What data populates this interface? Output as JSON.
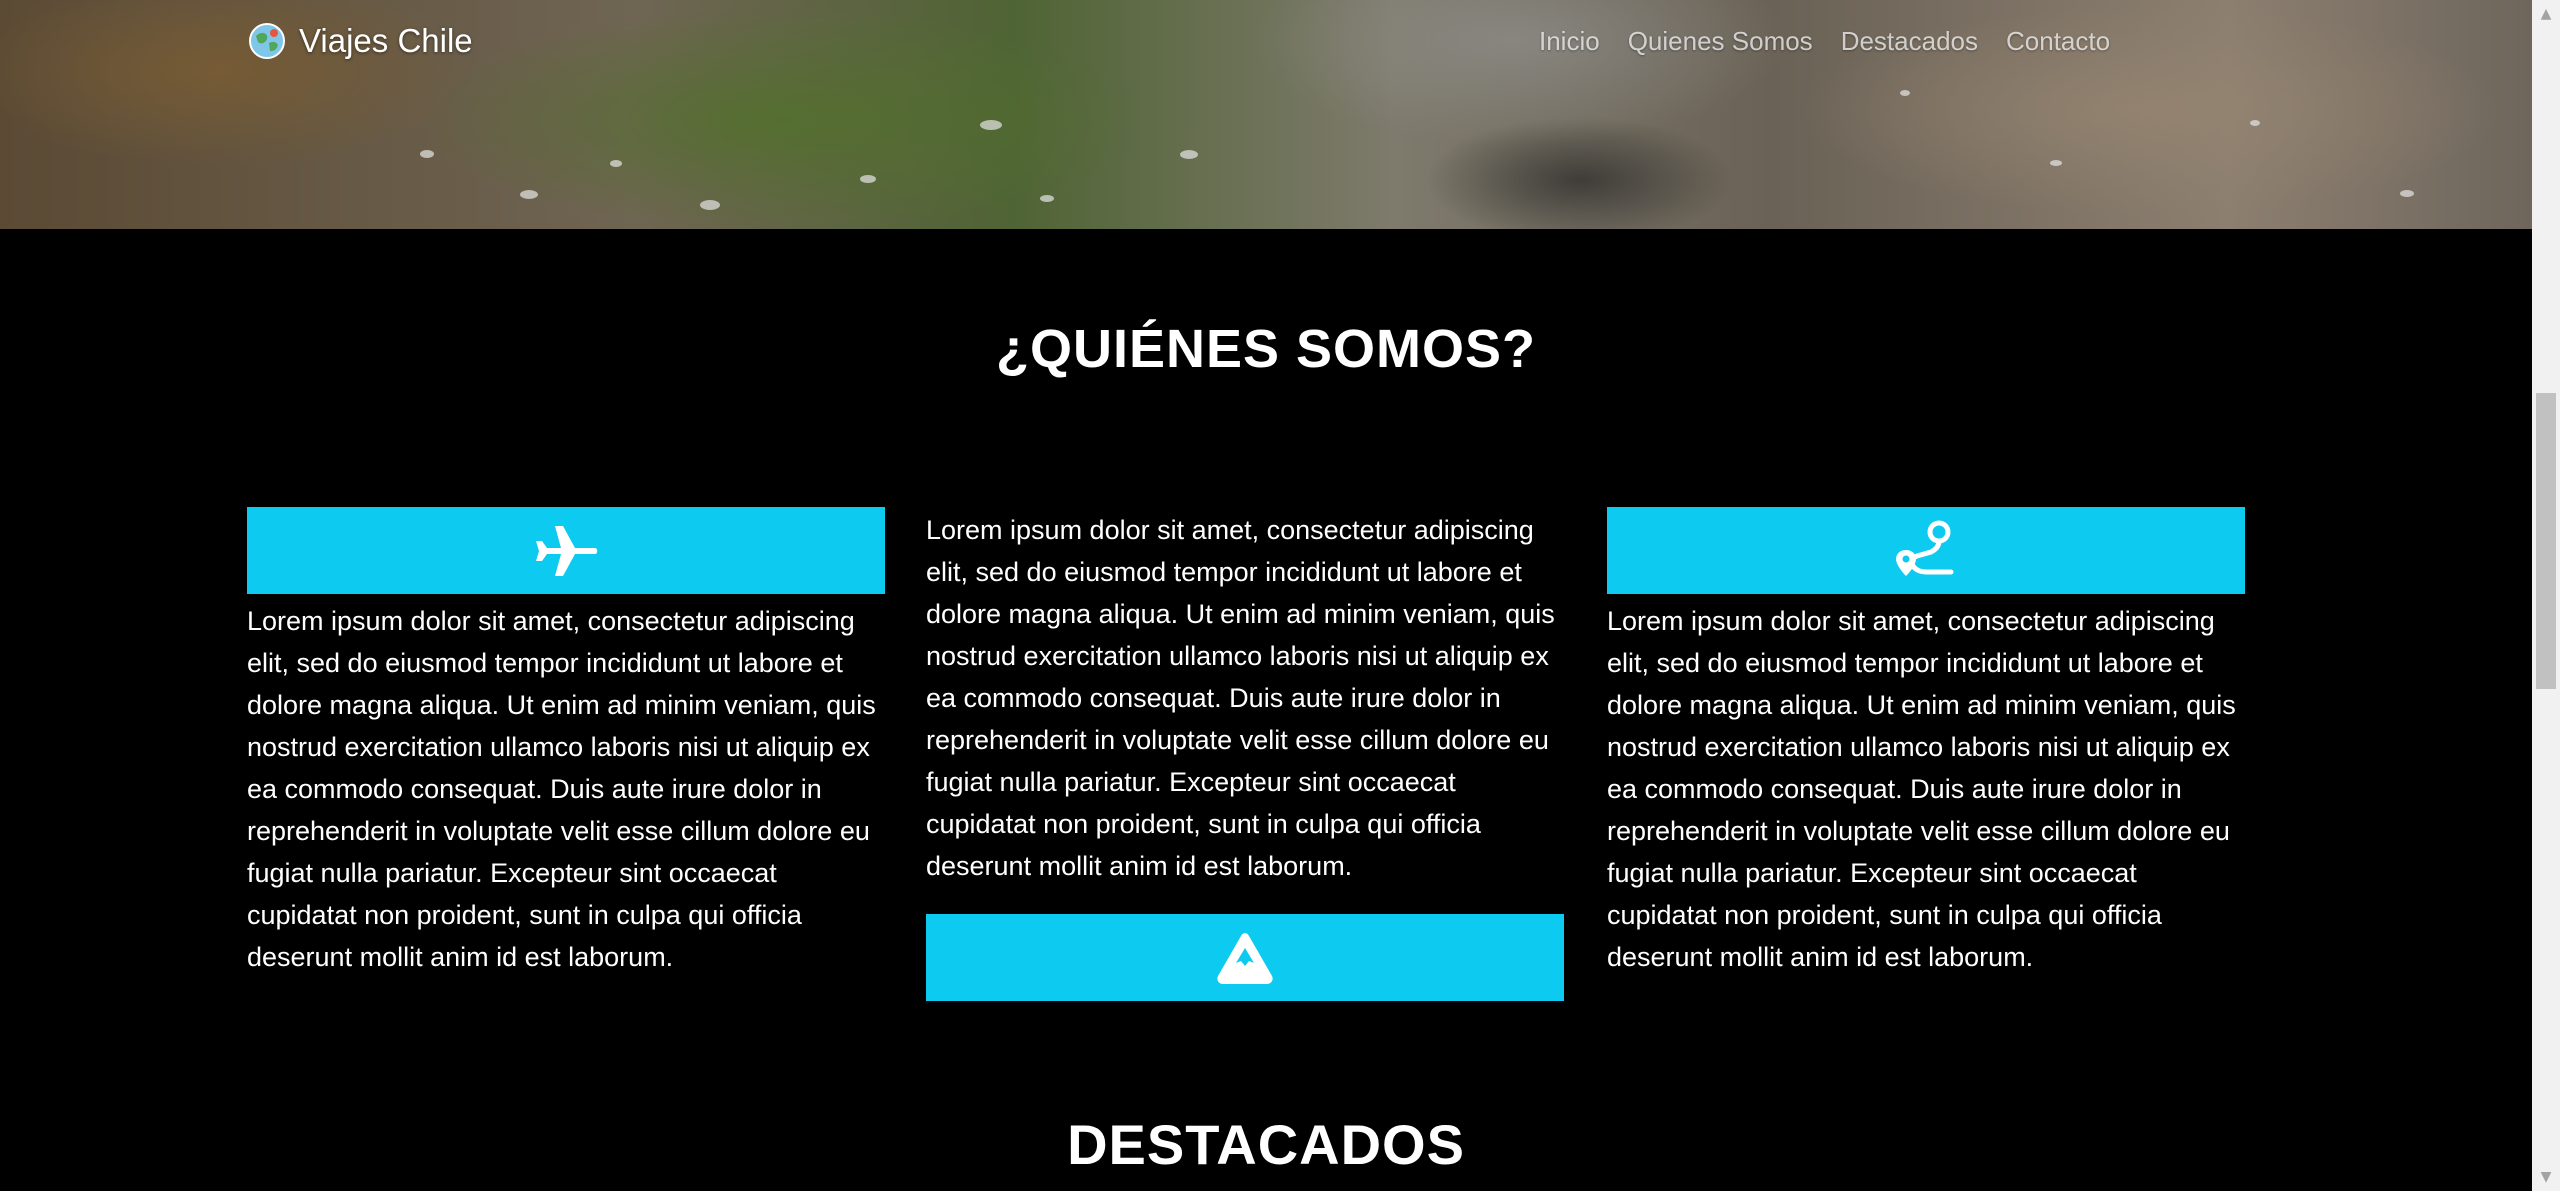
{
  "navbar": {
    "brand": "Viajes Chile",
    "links": [
      "Inicio",
      "Quienes Somos",
      "Destacados",
      "Contacto"
    ]
  },
  "about": {
    "title": "¿QUIÉNES SOMOS?",
    "columns": [
      {
        "icon": "airplane-icon",
        "text": "Lorem ipsum dolor sit amet, consectetur adipiscing elit, sed do eiusmod tempor incididunt ut labore et dolore magna aliqua. Ut enim ad minim veniam, quis nostrud exercitation ullamco laboris nisi ut aliquip ex ea commodo consequat. Duis aute irure dolor in reprehenderit in voluptate velit esse cillum dolore eu fugiat nulla pariatur. Excepteur sint occaecat cupidatat non proident, sunt in culpa qui officia deserunt mollit anim id est laborum."
      },
      {
        "icon": "mountain-icon",
        "text": "Lorem ipsum dolor sit amet, consectetur adipiscing elit, sed do eiusmod tempor incididunt ut labore et dolore magna aliqua. Ut enim ad minim veniam, quis nostrud exercitation ullamco laboris nisi ut aliquip ex ea commodo consequat. Duis aute irure dolor in reprehenderit in voluptate velit esse cillum dolore eu fugiat nulla pariatur. Excepteur sint occaecat cupidatat non proident, sunt in culpa qui officia deserunt mollit anim id est laborum."
      },
      {
        "icon": "route-pin-icon",
        "text": "Lorem ipsum dolor sit amet, consectetur adipiscing elit, sed do eiusmod tempor incididunt ut labore et dolore magna aliqua. Ut enim ad minim veniam, quis nostrud exercitation ullamco laboris nisi ut aliquip ex ea commodo consequat. Duis aute irure dolor in reprehenderit in voluptate velit esse cillum dolore eu fugiat nulla pariatur. Excepteur sint occaecat cupidatat non proident, sunt in culpa qui officia deserunt mollit anim id est laborum."
      }
    ]
  },
  "featured": {
    "title": "DESTACADOS"
  },
  "colors": {
    "accent": "#0dcaf0",
    "background": "#000000",
    "text": "#ffffff"
  }
}
